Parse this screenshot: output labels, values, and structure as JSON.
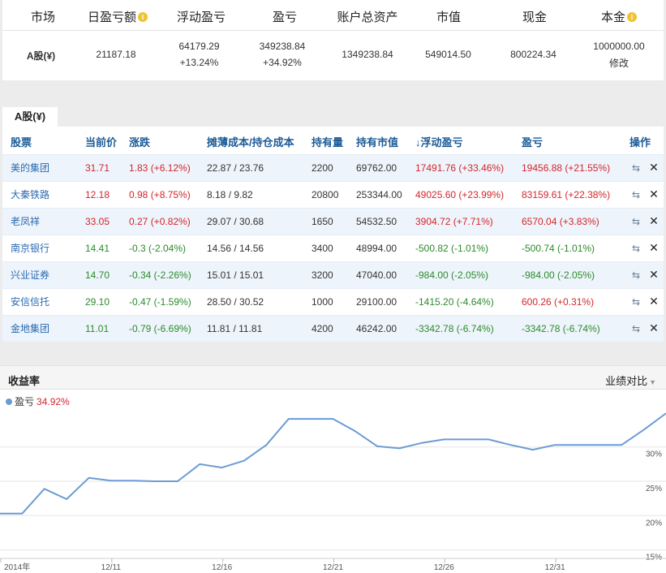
{
  "summary": {
    "headers": {
      "market": "市场",
      "daily_pnl": "日盈亏额",
      "floating_pnl": "浮动盈亏",
      "pnl": "盈亏",
      "total_assets": "账户总资产",
      "market_value": "市值",
      "cash": "现金",
      "principal": "本金"
    },
    "row": {
      "market": "A股(¥)",
      "daily_pnl": "21187.18",
      "floating_pnl": "64179.29",
      "floating_pnl_pct": "+13.24%",
      "pnl": "349238.84",
      "pnl_pct": "+34.92%",
      "total_assets": "1349238.84",
      "market_value": "549014.50",
      "cash": "800224.34",
      "principal": "1000000.00",
      "edit_label": "修改"
    }
  },
  "holdings": {
    "tab_label": "A股(¥)",
    "columns": [
      "股票",
      "当前价",
      "涨跌",
      "摊薄成本/持仓成本",
      "持有量",
      "持有市值",
      "浮动盈亏",
      "盈亏",
      "操作"
    ],
    "sort_indicator": "↓",
    "rows": [
      {
        "name": "美的集团",
        "price": "31.71",
        "change": "1.83 (+6.12%)",
        "cost": "22.87 / 23.76",
        "qty": "2200",
        "value": "69762.00",
        "float_pnl": "17491.76 (+33.46%)",
        "pnl": "19456.88 (+21.55%)",
        "dir": "up",
        "pnl_dir": "up"
      },
      {
        "name": "大秦铁路",
        "price": "12.18",
        "change": "0.98 (+8.75%)",
        "cost": "8.18 / 9.82",
        "qty": "20800",
        "value": "253344.00",
        "float_pnl": "49025.60 (+23.99%)",
        "pnl": "83159.61 (+22.38%)",
        "dir": "up",
        "pnl_dir": "up"
      },
      {
        "name": "老凤祥",
        "price": "33.05",
        "change": "0.27 (+0.82%)",
        "cost": "29.07 / 30.68",
        "qty": "1650",
        "value": "54532.50",
        "float_pnl": "3904.72 (+7.71%)",
        "pnl": "6570.04 (+3.83%)",
        "dir": "up",
        "pnl_dir": "up"
      },
      {
        "name": "南京银行",
        "price": "14.41",
        "change": "-0.3 (-2.04%)",
        "cost": "14.56 / 14.56",
        "qty": "3400",
        "value": "48994.00",
        "float_pnl": "-500.82 (-1.01%)",
        "pnl": "-500.74 (-1.01%)",
        "dir": "down",
        "pnl_dir": "down"
      },
      {
        "name": "兴业证券",
        "price": "14.70",
        "change": "-0.34 (-2.26%)",
        "cost": "15.01 / 15.01",
        "qty": "3200",
        "value": "47040.00",
        "float_pnl": "-984.00 (-2.05%)",
        "pnl": "-984.00 (-2.05%)",
        "dir": "down",
        "pnl_dir": "down"
      },
      {
        "name": "安信信托",
        "price": "29.10",
        "change": "-0.47 (-1.59%)",
        "cost": "28.50 / 30.52",
        "qty": "1000",
        "value": "29100.00",
        "float_pnl": "-1415.20 (-4.64%)",
        "pnl": "600.26 (+0.31%)",
        "dir": "down",
        "pnl_dir": "up"
      },
      {
        "name": "金地集团",
        "price": "11.01",
        "change": "-0.79 (-6.69%)",
        "cost": "11.81 / 11.81",
        "qty": "4200",
        "value": "46242.00",
        "float_pnl": "-3342.78 (-6.74%)",
        "pnl": "-3342.78 (-6.74%)",
        "dir": "down",
        "pnl_dir": "down"
      }
    ],
    "icons": {
      "swap": "swap-icon",
      "delete": "close-icon"
    }
  },
  "chart_header": {
    "title": "收益率",
    "compare_label": "业绩对比",
    "legend_name": "盈亏",
    "legend_value": "34.92%"
  },
  "colors": {
    "up": "#d2262b",
    "down": "#2c8a2c",
    "line": "#6c9bd4",
    "link": "#2a6ab0"
  },
  "chart_data": {
    "type": "line",
    "x_tick_labels": [
      "2014年",
      "12/11",
      "12/16",
      "12/21",
      "12/26",
      "12/31"
    ],
    "y_tick_labels": [
      "15%",
      "20%",
      "25%",
      "30%"
    ],
    "ylim": [
      14,
      36
    ],
    "series": [
      {
        "name": "盈亏",
        "values": [
          20.3,
          20.3,
          23.9,
          22.4,
          25.5,
          25.1,
          25.1,
          25.0,
          25.0,
          27.5,
          27.0,
          28.0,
          30.3,
          34.1,
          34.1,
          34.1,
          32.3,
          30.1,
          29.8,
          30.6,
          31.1,
          31.1,
          31.1,
          30.3,
          29.6,
          30.3,
          30.3,
          30.3,
          30.3,
          32.5,
          34.9
        ]
      }
    ]
  }
}
